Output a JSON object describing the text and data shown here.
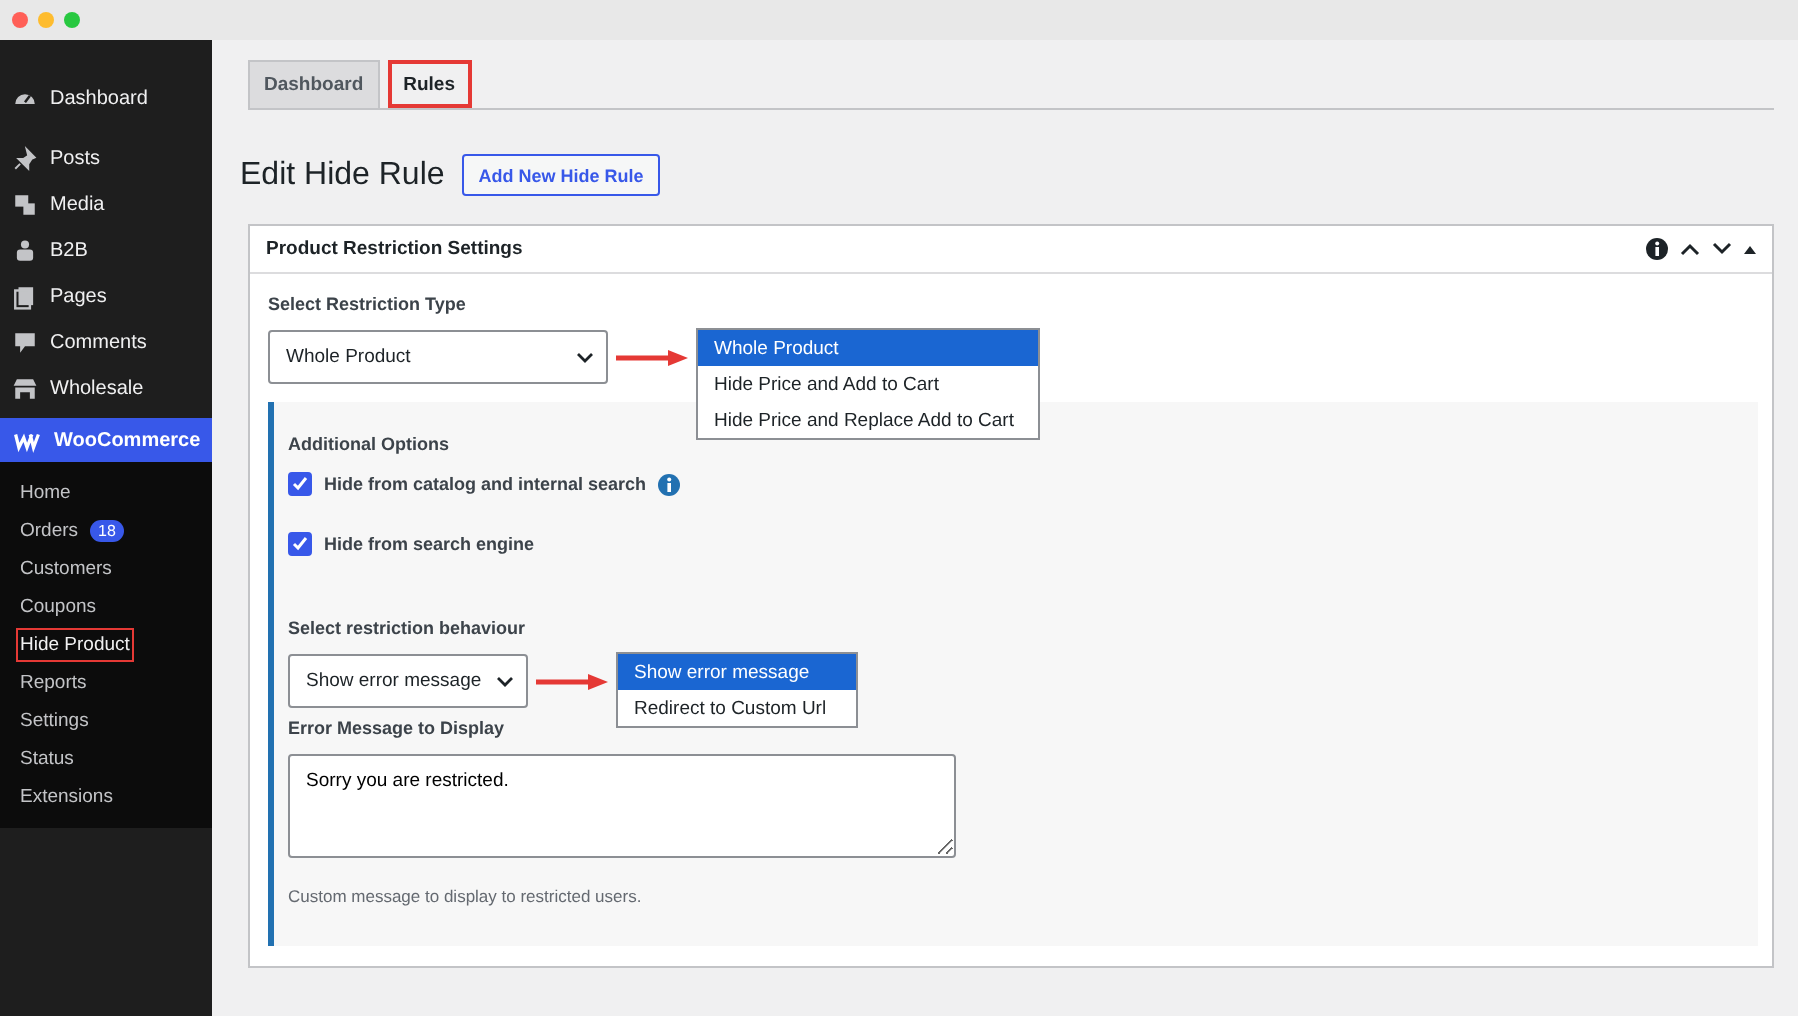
{
  "sidebar": {
    "menu": [
      {
        "label": "Dashboard"
      },
      {
        "label": "Posts"
      },
      {
        "label": "Media"
      },
      {
        "label": "B2B"
      },
      {
        "label": "Pages"
      },
      {
        "label": "Comments"
      },
      {
        "label": "Wholesale"
      }
    ],
    "active": {
      "label": "WooCommerce"
    },
    "submenu": [
      {
        "label": "Home",
        "highlighted": false
      },
      {
        "label": "Orders",
        "badge": "18",
        "highlighted": false
      },
      {
        "label": "Customers",
        "highlighted": false
      },
      {
        "label": "Coupons",
        "highlighted": false
      },
      {
        "label": "Hide Product",
        "highlighted": true
      },
      {
        "label": "Reports",
        "highlighted": false
      },
      {
        "label": "Settings",
        "highlighted": false
      },
      {
        "label": "Status",
        "highlighted": false
      },
      {
        "label": "Extensions",
        "highlighted": false
      }
    ]
  },
  "tabs": [
    {
      "label": "Dashboard",
      "selected": false,
      "highlighted": false
    },
    {
      "label": "Rules",
      "selected": true,
      "highlighted": true
    }
  ],
  "heading": "Edit Hide Rule",
  "add_button": "Add New Hide Rule",
  "card": {
    "title": "Product Restriction Settings",
    "restriction_type": {
      "label": "Select Restriction Type",
      "value": "Whole Product",
      "options": [
        {
          "label": "Whole Product",
          "selected": true
        },
        {
          "label": "Hide Price and Add to Cart",
          "selected": false
        },
        {
          "label": "Hide Price and Replace Add to Cart",
          "selected": false
        }
      ]
    },
    "additional_options": {
      "label": "Additional Options",
      "options": [
        {
          "label": "Hide from catalog and internal search",
          "checked": true,
          "info": true
        },
        {
          "label": "Hide from search engine",
          "checked": true,
          "info": false
        }
      ]
    },
    "behaviour": {
      "label": "Select restriction behaviour",
      "value": "Show error message",
      "options": [
        {
          "label": "Show error message",
          "selected": true
        },
        {
          "label": "Redirect to Custom Url",
          "selected": false
        }
      ]
    },
    "error_message": {
      "label": "Error Message to Display",
      "value": "Sorry you are restricted.",
      "help": "Custom message to display to restricted users."
    }
  }
}
